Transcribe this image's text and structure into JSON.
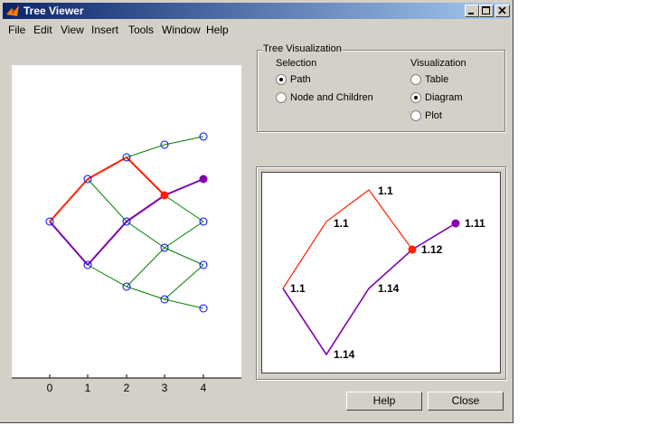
{
  "window": {
    "title": "Tree Viewer"
  },
  "menu": [
    "File",
    "Edit",
    "View",
    "Insert",
    "Tools",
    "Window",
    "Help"
  ],
  "colors": {
    "path": "#ff2000",
    "children": "#8000b0",
    "tree": "#008000",
    "node": "#0000ff"
  },
  "tree_plot": {
    "x_ticks": [
      "0",
      "1",
      "2",
      "3",
      "4"
    ]
  },
  "group": {
    "title": "Tree Visualization",
    "selection_label": "Selection",
    "selection_options": [
      "Path",
      "Node and Children"
    ],
    "selection_value": "Path",
    "visualization_label": "Visualization",
    "visualization_options": [
      "Table",
      "Diagram",
      "Plot"
    ],
    "visualization_value": "Diagram"
  },
  "diagram": {
    "labels": [
      "1.1",
      "1.1",
      "1.1",
      "1.12",
      "1.11",
      "1.14",
      "1.14"
    ]
  },
  "buttons": {
    "help": "Help",
    "close": "Close"
  }
}
